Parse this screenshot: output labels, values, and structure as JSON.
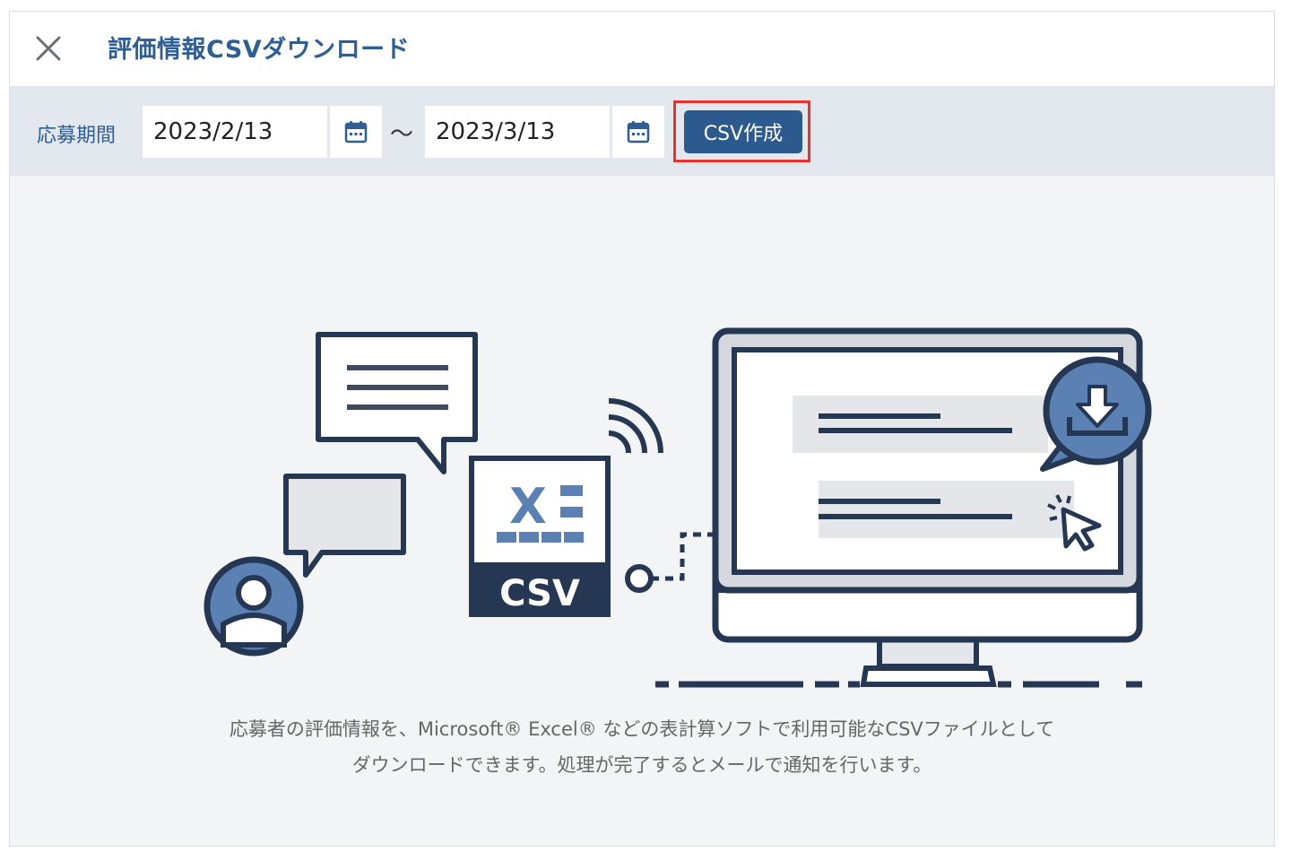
{
  "dialog": {
    "title": "評価情報CSVダウンロード",
    "close_icon": "close-icon"
  },
  "toolbar": {
    "period_label": "応募期間",
    "start_date": "2023/2/13",
    "end_date": "2023/3/13",
    "separator": "〜",
    "calendar_icon": "calendar-icon",
    "create_button_label": "CSV作成",
    "highlight_color": "#e8322b"
  },
  "illustration": {
    "csv_label": "CSV",
    "excel_glyph": "X",
    "icons": [
      "chat-bubble-icon",
      "user-avatar-icon",
      "csv-file-icon",
      "wifi-signal-icon",
      "monitor-icon",
      "download-icon",
      "cursor-click-icon"
    ]
  },
  "description": {
    "line1": "応募者の評価情報を、Microsoft® Excel® などの表計算ソフトで利用可能なCSVファイルとして",
    "line2": "ダウンロードできます。処理が完了するとメールで通知を行います。"
  },
  "colors": {
    "brand": "#2e5e93",
    "button": "#2d5a8e",
    "navy": "#253752",
    "accent_blue": "#5b80b3",
    "panel_gray": "#e4e6ea"
  }
}
